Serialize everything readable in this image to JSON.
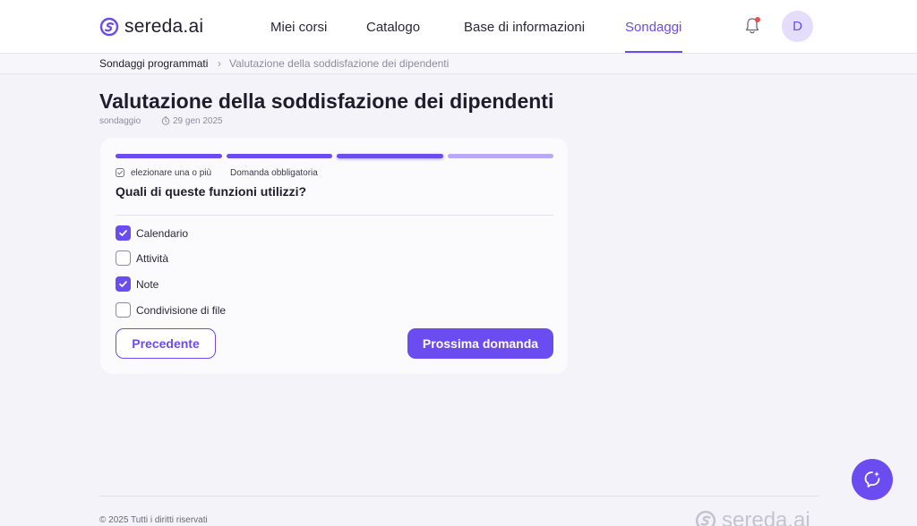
{
  "brand": {
    "name": "sereda.ai",
    "accent": "#6a4cf0"
  },
  "nav": {
    "items": [
      {
        "label": "Miei corsi",
        "active": false
      },
      {
        "label": "Catalogo",
        "active": false
      },
      {
        "label": "Base di informazioni",
        "active": false
      },
      {
        "label": "Sondaggi",
        "active": true
      }
    ],
    "notification_icon": "bell-icon",
    "has_unread_notifications": true,
    "avatar_initial": "D"
  },
  "breadcrumb": {
    "parent": "Sondaggi programmati",
    "current": "Valutazione della soddisfazione dei dipendenti"
  },
  "survey": {
    "title": "Valutazione della soddisfazione dei dipendenti",
    "type": "sondaggio",
    "date": "29 gen 2025",
    "progress": {
      "total_steps": 4,
      "current_step": 3
    },
    "hint_multi": "elezionare una o più",
    "hint_required": "Domanda obbligatoria",
    "question": "Quali di queste funzioni utilizzi?",
    "options": [
      {
        "label": "Calendario",
        "checked": true
      },
      {
        "label": "Attività",
        "checked": false
      },
      {
        "label": "Note",
        "checked": true
      },
      {
        "label": "Condivisione di file",
        "checked": false
      }
    ],
    "prev_label": "Precedente",
    "next_label": "Prossima domanda"
  },
  "assistant": {
    "icon": "ai-assistant-icon"
  },
  "footer": {
    "copyright": "© 2025 Tutti i diritti riservati",
    "logo_text": "sereda.ai"
  }
}
